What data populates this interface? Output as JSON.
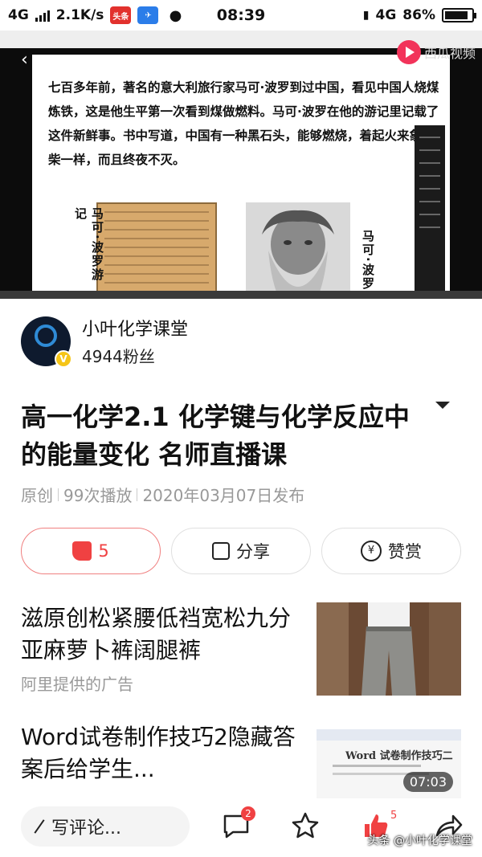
{
  "status_bar": {
    "network": "4G",
    "speed": "2.1K/s",
    "app_badge": "头条",
    "time": "08:39",
    "net_right": "4G",
    "battery": "86%",
    "battery_level": 0.86
  },
  "video": {
    "brand": "西瓜视频",
    "slide_text": "七百多年前，著名的意大利旅行家马可·波罗到过中国，看见中国人烧煤炼铁，这是他生平第一次看到煤做燃料。马可·波罗在他的游记里记载了这件新鲜事。书中写道，中国有一种黑石头，能够燃烧，着起火来象木柴一样，而且终夜不灭。",
    "label_book": "马可·波罗游记",
    "label_portrait": "马可·波罗"
  },
  "author": {
    "name": "小叶化学课堂",
    "fans": "4944粉丝",
    "verified": "V"
  },
  "article": {
    "title": "高一化学2.1 化学键与化学反应中的能量变化  名师直播课",
    "original": "原创",
    "plays": "99次播放",
    "date": "2020年03月07日发布"
  },
  "actions": {
    "like_count": "5",
    "share": "分享",
    "reward": "赞赏",
    "reward_icon": "¥"
  },
  "recommendations": [
    {
      "title": "滋原创松紧腰低裆宽松九分亚麻萝卜裤阔腿裤",
      "sub": "阿里提供的广告"
    },
    {
      "title": "Word试卷制作技巧2隐藏答案后给学生...",
      "duration": "07:03",
      "thumb_title": "Word 试卷制作技巧二"
    }
  ],
  "bottom_bar": {
    "comment_placeholder": "写评论...",
    "comment_badge": "2",
    "like_badge": "5",
    "watermark": "头条 @小叶化学课堂"
  },
  "colors": {
    "accent": "#f04142",
    "brand": "#f2335a"
  }
}
